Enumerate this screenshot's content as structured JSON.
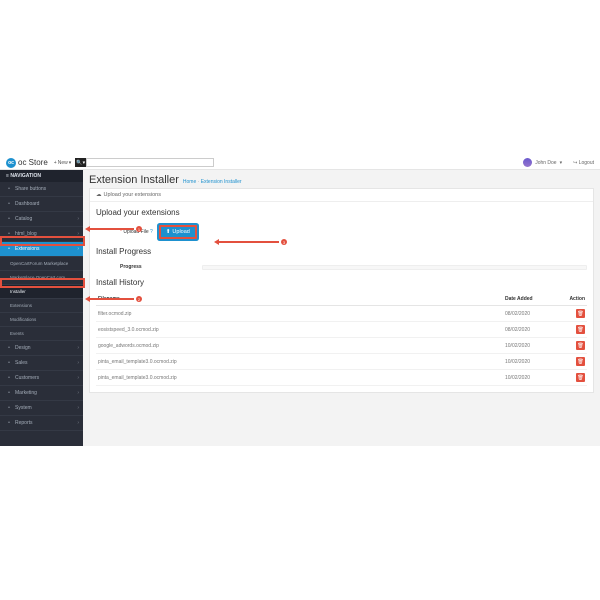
{
  "brand": "oc Store",
  "topbar": {
    "new": "New",
    "search_placeholder": "",
    "user": "John Doe",
    "logout": "Logout"
  },
  "sidebar": {
    "heading": "NAVIGATION",
    "items": [
      {
        "icon": "share",
        "label": "Share buttons"
      },
      {
        "icon": "dash",
        "label": "Dashboard"
      },
      {
        "icon": "tag",
        "label": "Catalog",
        "chev": true
      },
      {
        "icon": "doc",
        "label": "html_blog",
        "chev": true
      },
      {
        "icon": "puzzle",
        "label": "Extensions",
        "chev": true,
        "active": true
      },
      {
        "icon": "",
        "label": "OpenCartForum Marketplace",
        "sub": true
      },
      {
        "icon": "",
        "label": "Marketplace OpenCart.com",
        "sub": true
      },
      {
        "icon": "",
        "label": "Installer",
        "sub": true,
        "open": true
      },
      {
        "icon": "",
        "label": "Extensions",
        "sub": true
      },
      {
        "icon": "",
        "label": "Modifications",
        "sub": true
      },
      {
        "icon": "",
        "label": "Events",
        "sub": true
      },
      {
        "icon": "tv",
        "label": "Design",
        "chev": true
      },
      {
        "icon": "cart",
        "label": "Sales",
        "chev": true
      },
      {
        "icon": "user",
        "label": "Customers",
        "chev": true
      },
      {
        "icon": "share2",
        "label": "Marketing",
        "chev": true
      },
      {
        "icon": "gear",
        "label": "System",
        "chev": true
      },
      {
        "icon": "stats",
        "label": "Reports",
        "chev": true
      }
    ]
  },
  "page": {
    "title": "Extension Installer",
    "crumb_home": "Home",
    "crumb_page": "Extension Installer",
    "panel_heading": "Upload your extensions",
    "upload_section": "Upload your extensions",
    "upload_label": "Upload File",
    "upload_btn": "Upload",
    "progress_section": "Install Progress",
    "progress_label": "Progress",
    "history_section": "Install History",
    "cols": {
      "filename": "Filename",
      "date": "Date Added",
      "action": "Action"
    },
    "rows": [
      {
        "filename": "filter.ocmod.zip",
        "date": "08/02/2020"
      },
      {
        "filename": "eosistspeed_3.0.ocmod.zip",
        "date": "08/02/2020"
      },
      {
        "filename": "google_adwords.ocmod.zip",
        "date": "10/02/2020"
      },
      {
        "filename": "pinta_email_template3.0.ocmod.zip",
        "date": "10/02/2020"
      },
      {
        "filename": "pinta_email_template3.0.ocmod.zip",
        "date": "10/02/2020"
      }
    ]
  },
  "ann": {
    "n1": "1",
    "n2": "2",
    "n3": "3"
  },
  "icons": {
    "cloud": "☁",
    "plus": "+",
    "search": "🔍",
    "caret": "▾",
    "chev": "›",
    "upload": "⬆",
    "trash": "🗑"
  }
}
